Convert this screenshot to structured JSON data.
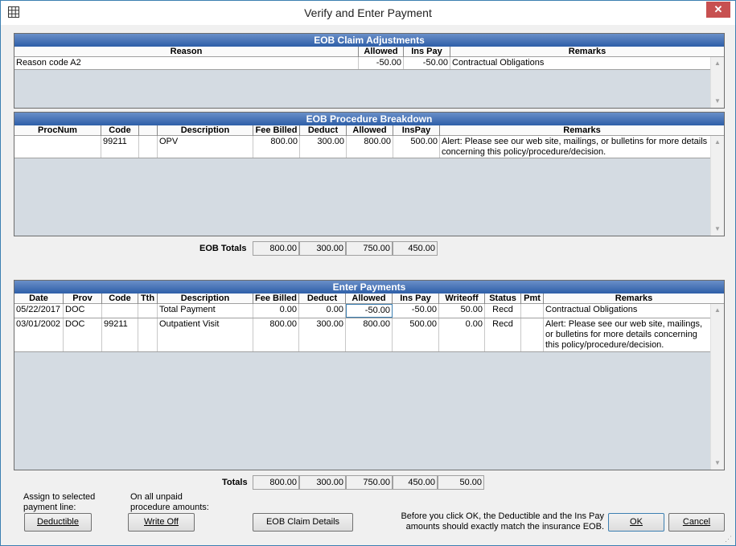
{
  "window": {
    "title": "Verify and Enter Payment",
    "close_glyph": "✕"
  },
  "claim_adjustments": {
    "title": "EOB Claim Adjustments",
    "columns": [
      "Reason",
      "Allowed",
      "Ins Pay",
      "Remarks"
    ],
    "rows": [
      {
        "reason": "Reason code A2",
        "allowed": "-50.00",
        "ins_pay": "-50.00",
        "remarks": "Contractual Obligations"
      }
    ]
  },
  "procedure_breakdown": {
    "title": "EOB Procedure Breakdown",
    "columns": [
      "ProcNum",
      "Code",
      "",
      "Description",
      "Fee Billed",
      "Deduct",
      "Allowed",
      "InsPay",
      "Remarks"
    ],
    "rows": [
      {
        "procnum": "",
        "code": "99211",
        "tth": "",
        "description": "OPV",
        "fee_billed": "800.00",
        "deduct": "300.00",
        "allowed": "800.00",
        "ins_pay": "500.00",
        "remarks": "Alert: Please see our web site, mailings, or bulletins for more details concerning this policy/procedure/decision."
      }
    ]
  },
  "eob_totals": {
    "label": "EOB Totals",
    "fee_billed": "800.00",
    "deduct": "300.00",
    "allowed": "750.00",
    "ins_pay": "450.00"
  },
  "enter_payments": {
    "title": "Enter Payments",
    "columns": [
      "Date",
      "Prov",
      "Code",
      "Tth",
      "Description",
      "Fee Billed",
      "Deduct",
      "Allowed",
      "Ins Pay",
      "Writeoff",
      "Status",
      "Pmt",
      "Remarks"
    ],
    "rows": [
      {
        "date": "05/22/2017",
        "prov": "DOC",
        "code": "",
        "tth": "",
        "description": "Total Payment",
        "fee_billed": "0.00",
        "deduct": "0.00",
        "allowed": "-50.00",
        "ins_pay": "-50.00",
        "writeoff": "50.00",
        "status": "Recd",
        "pmt": "",
        "remarks": "Contractual Obligations"
      },
      {
        "date": "03/01/2002",
        "prov": "DOC",
        "code": "99211",
        "tth": "",
        "description": "Outpatient Visit",
        "fee_billed": "800.00",
        "deduct": "300.00",
        "allowed": "800.00",
        "ins_pay": "500.00",
        "writeoff": "0.00",
        "status": "Recd",
        "pmt": "",
        "remarks": "Alert: Please see our web site, mailings, or bulletins for more details concerning this policy/procedure/decision."
      }
    ]
  },
  "totals": {
    "label": "Totals",
    "fee_billed": "800.00",
    "deduct": "300.00",
    "allowed": "750.00",
    "ins_pay": "450.00",
    "writeoff": "50.00"
  },
  "footer": {
    "assign_note": "Assign to selected payment line:",
    "deductible_label": "Deductible",
    "unpaid_note": "On all unpaid procedure amounts:",
    "writeoff_label": "Write Off",
    "claim_details_label": "EOB Claim Details",
    "ok_note": "Before you click OK, the Deductible and the Ins Pay amounts should exactly match the insurance EOB.",
    "ok_label": "OK",
    "cancel_label": "Cancel"
  }
}
